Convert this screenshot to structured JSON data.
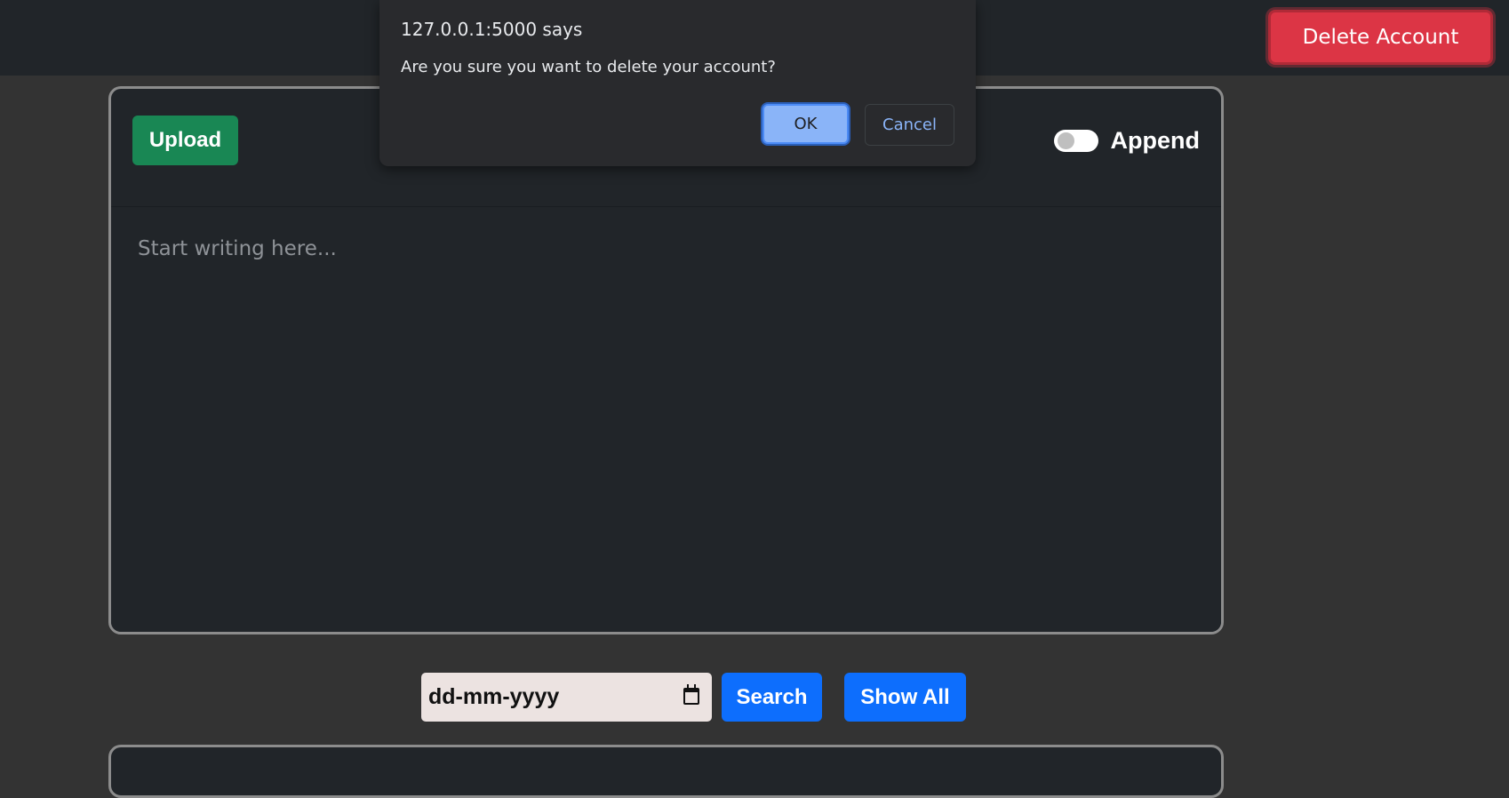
{
  "header": {
    "delete_account_label": "Delete Account"
  },
  "editor": {
    "upload_label": "Upload",
    "append_label": "Append",
    "append_enabled": false,
    "placeholder": "Start writing here..."
  },
  "search": {
    "date_placeholder": "dd-mm-yyyy",
    "search_label": "Search",
    "show_all_label": "Show All"
  },
  "dialog": {
    "title": "127.0.0.1:5000 says",
    "message": "Are you sure you want to delete your account?",
    "ok_label": "OK",
    "cancel_label": "Cancel"
  },
  "icons": {
    "date_picker": "calendar-icon"
  },
  "colors": {
    "page_background": "#333333",
    "topbar_background": "#212529",
    "delete_button": "#dc3545",
    "upload_button": "#198754",
    "primary_button": "#0d6efd",
    "dialog_background": "#292a2d",
    "dialog_accent": "#8ab4f8"
  }
}
